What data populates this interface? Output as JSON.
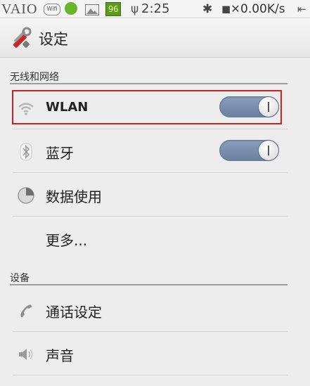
{
  "status_bar": {
    "brand": "VAIO",
    "wifi_badge": "Wifi",
    "battery": "96",
    "time": "2:25",
    "net_speed": "0.00K/s"
  },
  "header": {
    "title": "设定",
    "icon": "settings-tools-icon"
  },
  "sections": [
    {
      "label": "无线和网络",
      "items": [
        {
          "label": "WLAN",
          "icon": "wifi-icon",
          "toggle": "on"
        },
        {
          "label": "蓝牙",
          "icon": "bluetooth-icon",
          "toggle": "on"
        },
        {
          "label": "数据使用",
          "icon": "data-usage-icon"
        },
        {
          "label": "更多..."
        }
      ]
    },
    {
      "label": "设备",
      "items": [
        {
          "label": "通话设定",
          "icon": "phone-icon"
        },
        {
          "label": "声音",
          "icon": "speaker-icon"
        }
      ]
    }
  ],
  "colors": {
    "toggle_on": "#7890b0",
    "highlight": "#d32121",
    "background": "#ededed"
  }
}
